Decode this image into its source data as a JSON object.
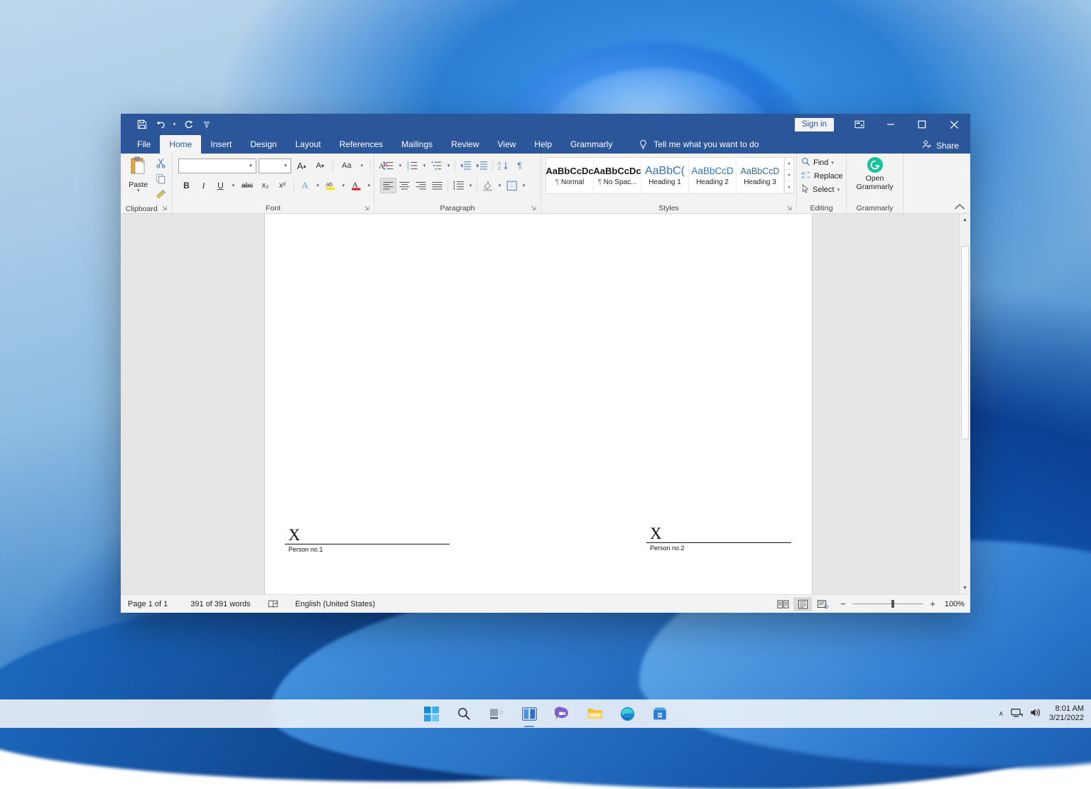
{
  "window": {
    "quick_access": [
      {
        "name": "save-icon",
        "label": "Save"
      },
      {
        "name": "undo-icon",
        "label": "Undo"
      },
      {
        "name": "redo-icon",
        "label": "Redo"
      },
      {
        "name": "customize-quick-access-icon",
        "label": "Customize Quick Access Toolbar"
      }
    ],
    "sign_in_label": "Sign in",
    "ribbon_display_options_label": "Ribbon Display Options",
    "minimize_label": "Minimize",
    "maximize_label": "Restore Down",
    "close_label": "Close",
    "titlebar_color": "#2b579a"
  },
  "tabs": [
    {
      "label": "File",
      "active": false
    },
    {
      "label": "Home",
      "active": true
    },
    {
      "label": "Insert",
      "active": false
    },
    {
      "label": "Design",
      "active": false
    },
    {
      "label": "Layout",
      "active": false
    },
    {
      "label": "References",
      "active": false
    },
    {
      "label": "Mailings",
      "active": false
    },
    {
      "label": "Review",
      "active": false
    },
    {
      "label": "View",
      "active": false
    },
    {
      "label": "Help",
      "active": false
    },
    {
      "label": "Grammarly",
      "active": false
    }
  ],
  "tell_me": {
    "placeholder": "Tell me what you want to do",
    "icon": "lightbulb-icon"
  },
  "share": {
    "label": "Share",
    "icon": "share-person-icon"
  },
  "ribbon": {
    "clipboard": {
      "group_label": "Clipboard",
      "paste_label": "Paste",
      "cut_label": "Cut",
      "copy_label": "Copy",
      "format_painter_label": "Format Painter",
      "dialog_launcher": "⇲"
    },
    "font": {
      "group_label": "Font",
      "font_name_value": "",
      "font_name_placeholder": "",
      "font_size_value": "",
      "font_size_placeholder": "",
      "grow_font_label": "A",
      "shrink_font_label": "A",
      "change_case_label": "Aa",
      "clear_formatting_label": "Clear All Formatting",
      "bold_label": "B",
      "italic_label": "I",
      "underline_label": "U",
      "strikethrough_label": "abc",
      "subscript_label": "x₂",
      "superscript_label": "x²",
      "text_effects_label": "A",
      "highlight_label": "ab",
      "font_color_label": "A",
      "dialog_launcher": "⇲"
    },
    "paragraph": {
      "group_label": "Paragraph",
      "bullets_label": "Bullets",
      "numbering_label": "Numbering",
      "multilevel_label": "Multilevel List",
      "decrease_indent_label": "Decrease Indent",
      "increase_indent_label": "Increase Indent",
      "sort_label": "Sort",
      "show_marks_label": "¶",
      "align_left_label": "Align Left",
      "align_center_label": "Center",
      "align_right_label": "Align Right",
      "justify_label": "Justify",
      "line_spacing_label": "Line and Paragraph Spacing",
      "shading_label": "Shading",
      "borders_label": "Borders",
      "dialog_launcher": "⇲"
    },
    "styles": {
      "group_label": "Styles",
      "items": [
        {
          "preview": "AaBbCcDc",
          "name": "Normal",
          "marker": "¶",
          "color": "#1a1a1a",
          "size": "13px",
          "bold": true
        },
        {
          "preview": "AaBbCcDc",
          "name": "No Spac...",
          "marker": "¶",
          "color": "#1a1a1a",
          "size": "13px",
          "bold": true
        },
        {
          "preview": "AaBbC(",
          "name": "Heading 1",
          "marker": "",
          "color": "#2e74b5",
          "size": "16px",
          "bold": false
        },
        {
          "preview": "AaBbCcD",
          "name": "Heading 2",
          "marker": "",
          "color": "#2e74b5",
          "size": "13.5px",
          "bold": false
        },
        {
          "preview": "AaBbCcD",
          "name": "Heading 3",
          "marker": "",
          "color": "#31688c",
          "size": "12.5px",
          "bold": false
        }
      ],
      "dialog_launcher": "⇲"
    },
    "editing": {
      "group_label": "Editing",
      "find_label": "Find",
      "replace_label": "Replace",
      "select_label": "Select"
    },
    "grammarly": {
      "group_label": "Grammarly",
      "button_line1": "Open",
      "button_line2": "Grammarly",
      "logo_letter": "G",
      "logo_color": "#15c39a"
    },
    "collapse_ribbon_label": "Collapse the Ribbon"
  },
  "document": {
    "signatures": [
      {
        "mark": "X",
        "caption": "Person no.1"
      },
      {
        "mark": "X",
        "caption": "Person no.2"
      }
    ]
  },
  "statusbar": {
    "page_label": "Page 1 of 1",
    "word_count": "391 of 391 words",
    "proofing_icon": "proofing-errors-icon",
    "language": "English (United States)",
    "views": [
      {
        "name": "read-mode-icon",
        "active": false
      },
      {
        "name": "print-layout-icon",
        "active": true
      },
      {
        "name": "web-layout-icon",
        "active": false
      }
    ],
    "zoom_out": "−",
    "zoom_in": "+",
    "zoom_percent": "100%"
  },
  "taskbar": {
    "apps": [
      {
        "name": "start-button",
        "label": "Start"
      },
      {
        "name": "search-icon",
        "label": "Search"
      },
      {
        "name": "task-view-icon",
        "label": "Task View"
      },
      {
        "name": "widgets-icon",
        "label": "Widgets"
      },
      {
        "name": "chat-icon",
        "label": "Chat"
      },
      {
        "name": "file-explorer-icon",
        "label": "File Explorer"
      },
      {
        "name": "microsoft-edge-icon",
        "label": "Microsoft Edge"
      },
      {
        "name": "microsoft-store-icon",
        "label": "Microsoft Store"
      }
    ],
    "tray": {
      "show_hidden_icons": "∧",
      "network_icon": "network-icon",
      "volume_icon": "volume-icon",
      "time": "8:01 AM",
      "date": "3/21/2022"
    }
  }
}
